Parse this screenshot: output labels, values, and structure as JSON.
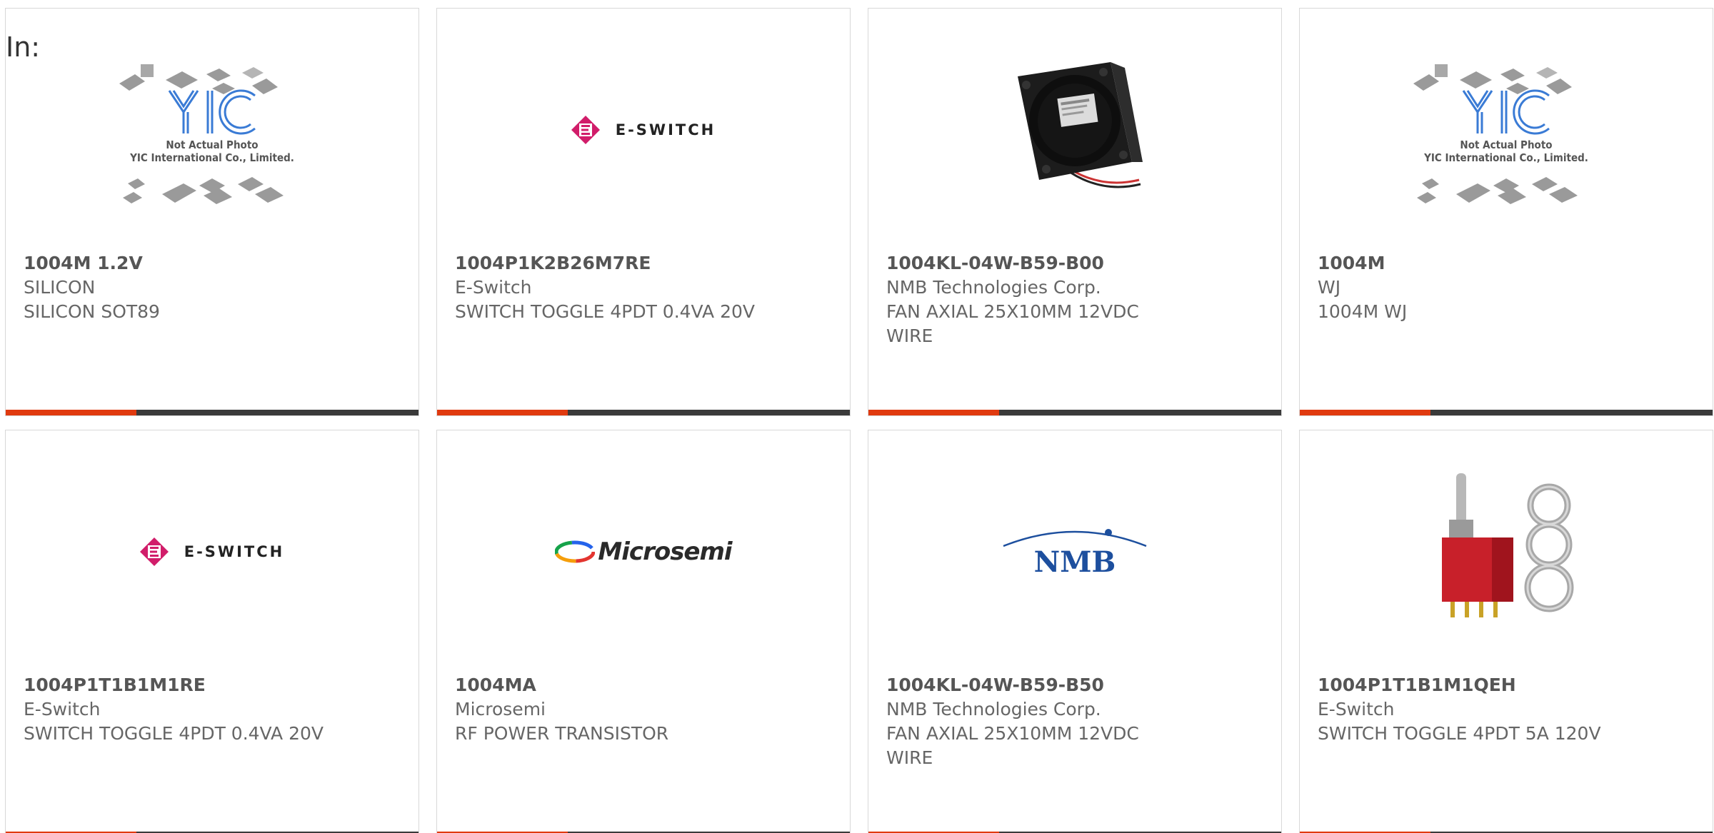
{
  "header": {
    "in_label": "In:"
  },
  "colors": {
    "accent_bar": "#e03a0f",
    "bar": "#3a3a3a",
    "eswitch_brand": "#d11d6a",
    "nmb_brand": "#1d4f9e"
  },
  "yic_placeholder": {
    "line1": "Not Actual Photo",
    "line2": "YIC International Co., Limited."
  },
  "logos": {
    "eswitch": "E-SWITCH",
    "microsemi": "Microsemi",
    "nmb": "NMB"
  },
  "products": [
    {
      "part_number": "1004M 1.2V",
      "manufacturer": "SILICON",
      "description": "SILICON SOT89",
      "image": "yic-placeholder-icon"
    },
    {
      "part_number": "1004P1K2B26M7RE",
      "manufacturer": "E-Switch",
      "description": "SWITCH TOGGLE 4PDT 0.4VA 20V",
      "image": "eswitch-logo"
    },
    {
      "part_number": "1004KL-04W-B59-B00",
      "manufacturer": "NMB Technologies Corp.",
      "description": "FAN AXIAL 25X10MM 12VDC WIRE",
      "image": "fan-photo"
    },
    {
      "part_number": "1004M",
      "manufacturer": "WJ",
      "description": "1004M WJ",
      "image": "yic-placeholder-icon"
    },
    {
      "part_number": "1004P1T1B1M1RE",
      "manufacturer": "E-Switch",
      "description": "SWITCH TOGGLE 4PDT 0.4VA 20V",
      "image": "eswitch-logo"
    },
    {
      "part_number": "1004MA",
      "manufacturer": "Microsemi",
      "description": "RF POWER TRANSISTOR",
      "image": "microsemi-logo"
    },
    {
      "part_number": "1004KL-04W-B59-B50",
      "manufacturer": "NMB Technologies Corp.",
      "description": "FAN AXIAL 25X10MM 12VDC WIRE",
      "image": "nmb-logo"
    },
    {
      "part_number": "1004P1T1B1M1QEH",
      "manufacturer": "E-Switch",
      "description": "SWITCH TOGGLE 4PDT 5A 120V",
      "image": "toggle-switch-photo"
    }
  ]
}
